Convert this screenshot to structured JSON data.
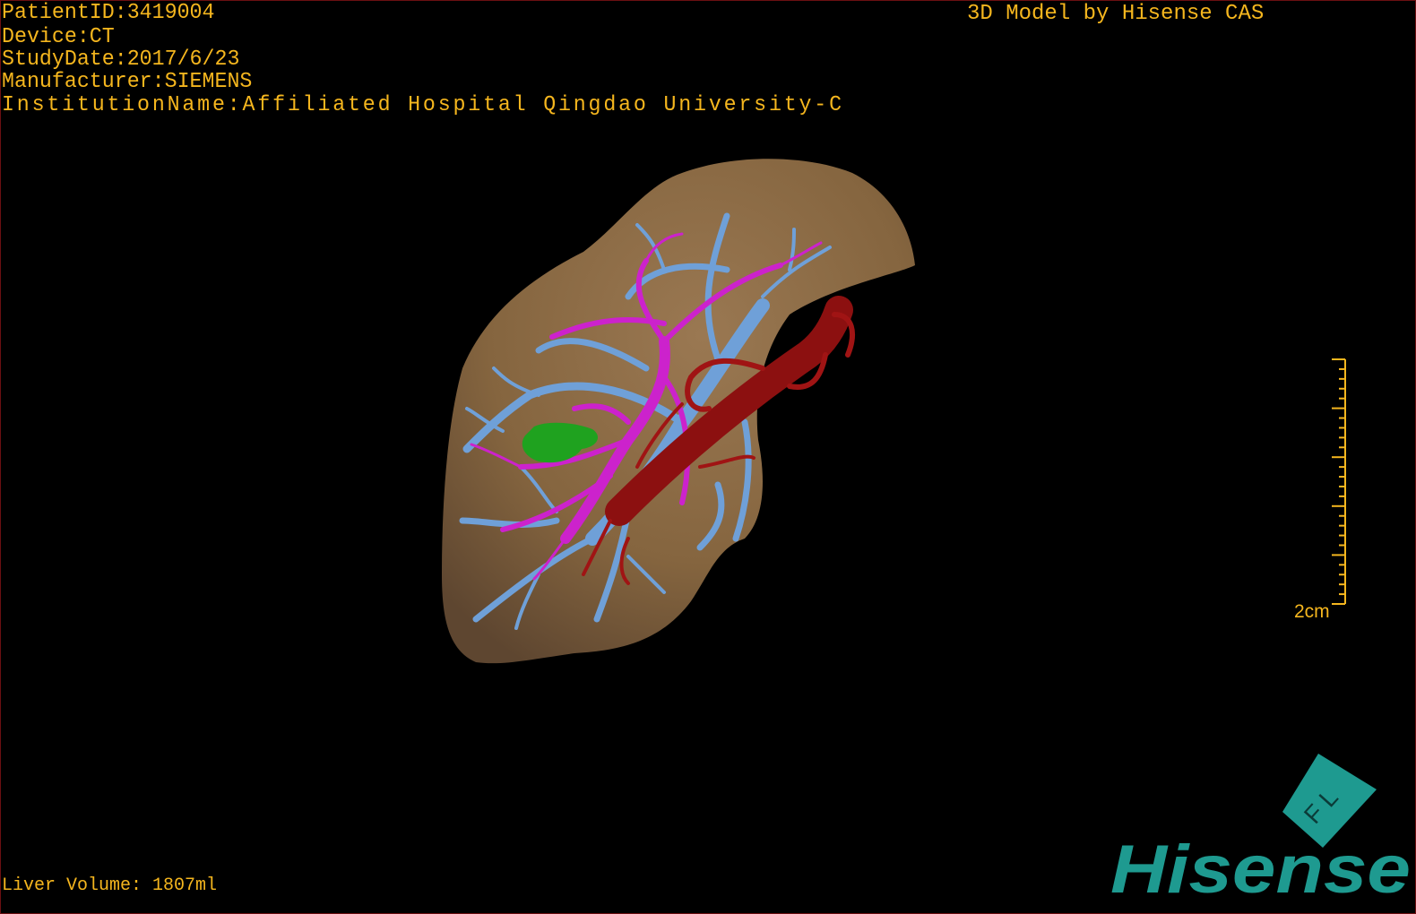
{
  "overlay": {
    "patient_id": "PatientID:3419004",
    "device": "Device:CT",
    "study_date": "StudyDate:2017/6/23",
    "manufacturer": "Manufacturer:SIEMENS",
    "institution": "InstitutionName:Affiliated Hospital Qingdao University-C",
    "model_credit": "3D Model by Hisense CAS",
    "liver_volume": "Liver Volume: 1807ml",
    "scale_label": "2cm"
  },
  "logo": {
    "brand": "Hisense",
    "cube_letters": "F L",
    "color": "#1e9a90"
  },
  "colors": {
    "text": "#f5b61e",
    "liver": "#8a6a48",
    "portal_vein": "#6fa0d8",
    "hepatic_artery": "#cc22cc",
    "ivc_artery": "#a01414",
    "tumor": "#1fa21f"
  }
}
